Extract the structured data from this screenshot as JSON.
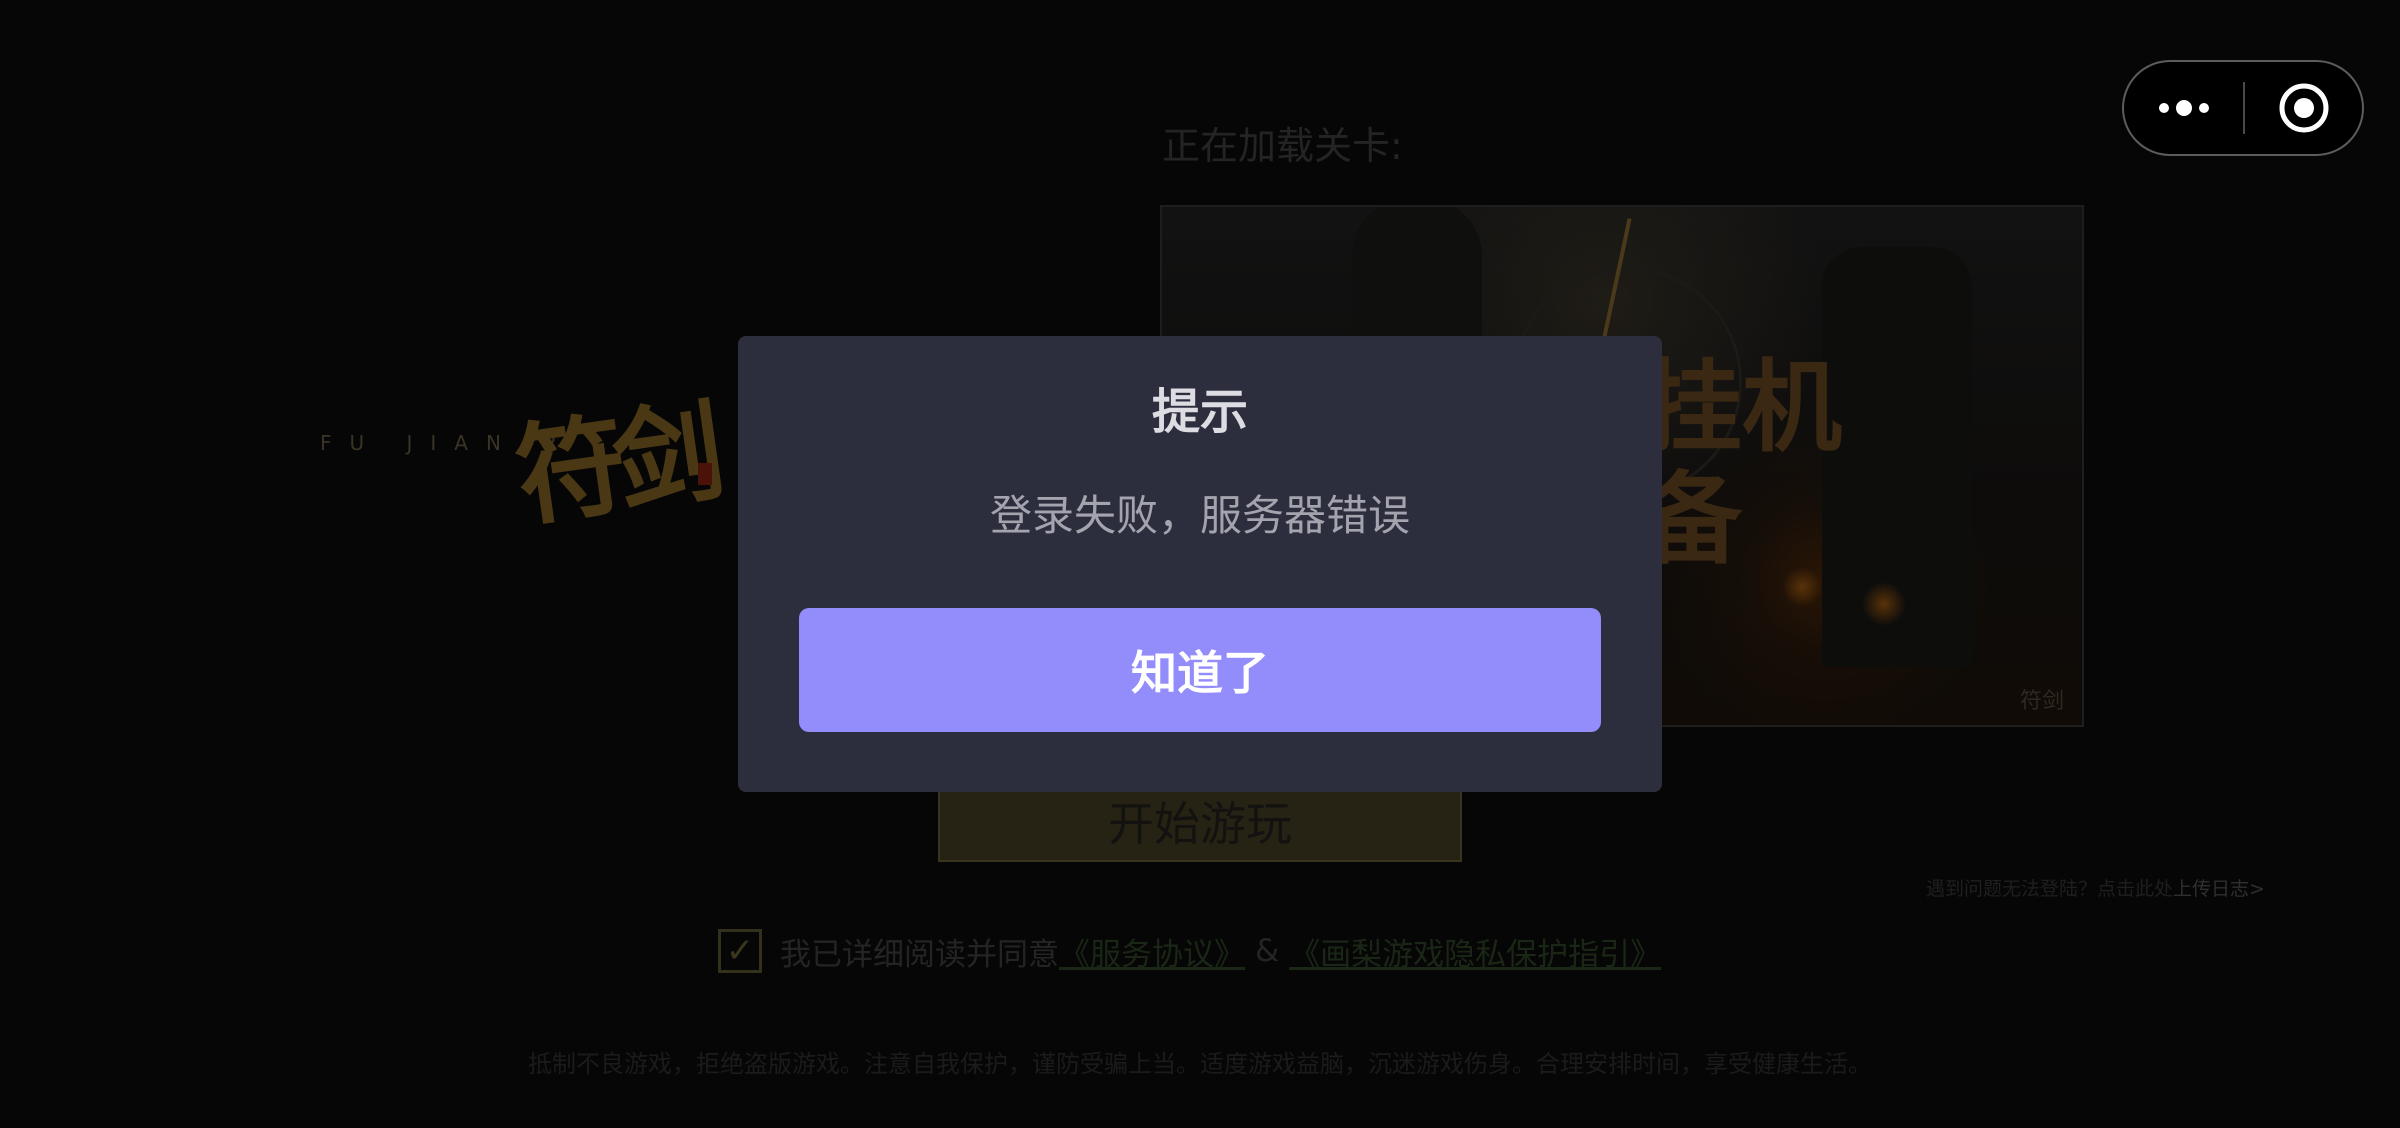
{
  "background": {
    "logo": {
      "subtitle": "FU  JIAN  R",
      "glyph": "符剑"
    },
    "loading_title": "正在加载关卡:",
    "level_card": {
      "text_line1": "挂机",
      "text_line2": "备",
      "watermark": "符剑"
    },
    "start_button": "开始游玩",
    "help": {
      "text": "遇到问题无法登陆？点击此处",
      "link": "上传日志>"
    },
    "agreement": {
      "checked_mark": "✓",
      "text": "我已详细阅读并同意",
      "service_link": "《服务协议》",
      "amp": "&",
      "privacy_link": "《画梨游戏隐私保护指引》"
    },
    "footer_notice": "抵制不良游戏，拒绝盗版游戏。注意自我保护，谨防受骗上当。适度游戏益脑，沉迷游戏伤身。合理安排时间，享受健康生活。"
  },
  "capsule": {
    "more_icon": "more-dots-icon",
    "close_icon": "target-close-icon"
  },
  "dialog": {
    "title": "提示",
    "message": "登录失败，服务器错误",
    "confirm_label": "知道了",
    "accent_color": "#938cfb"
  }
}
